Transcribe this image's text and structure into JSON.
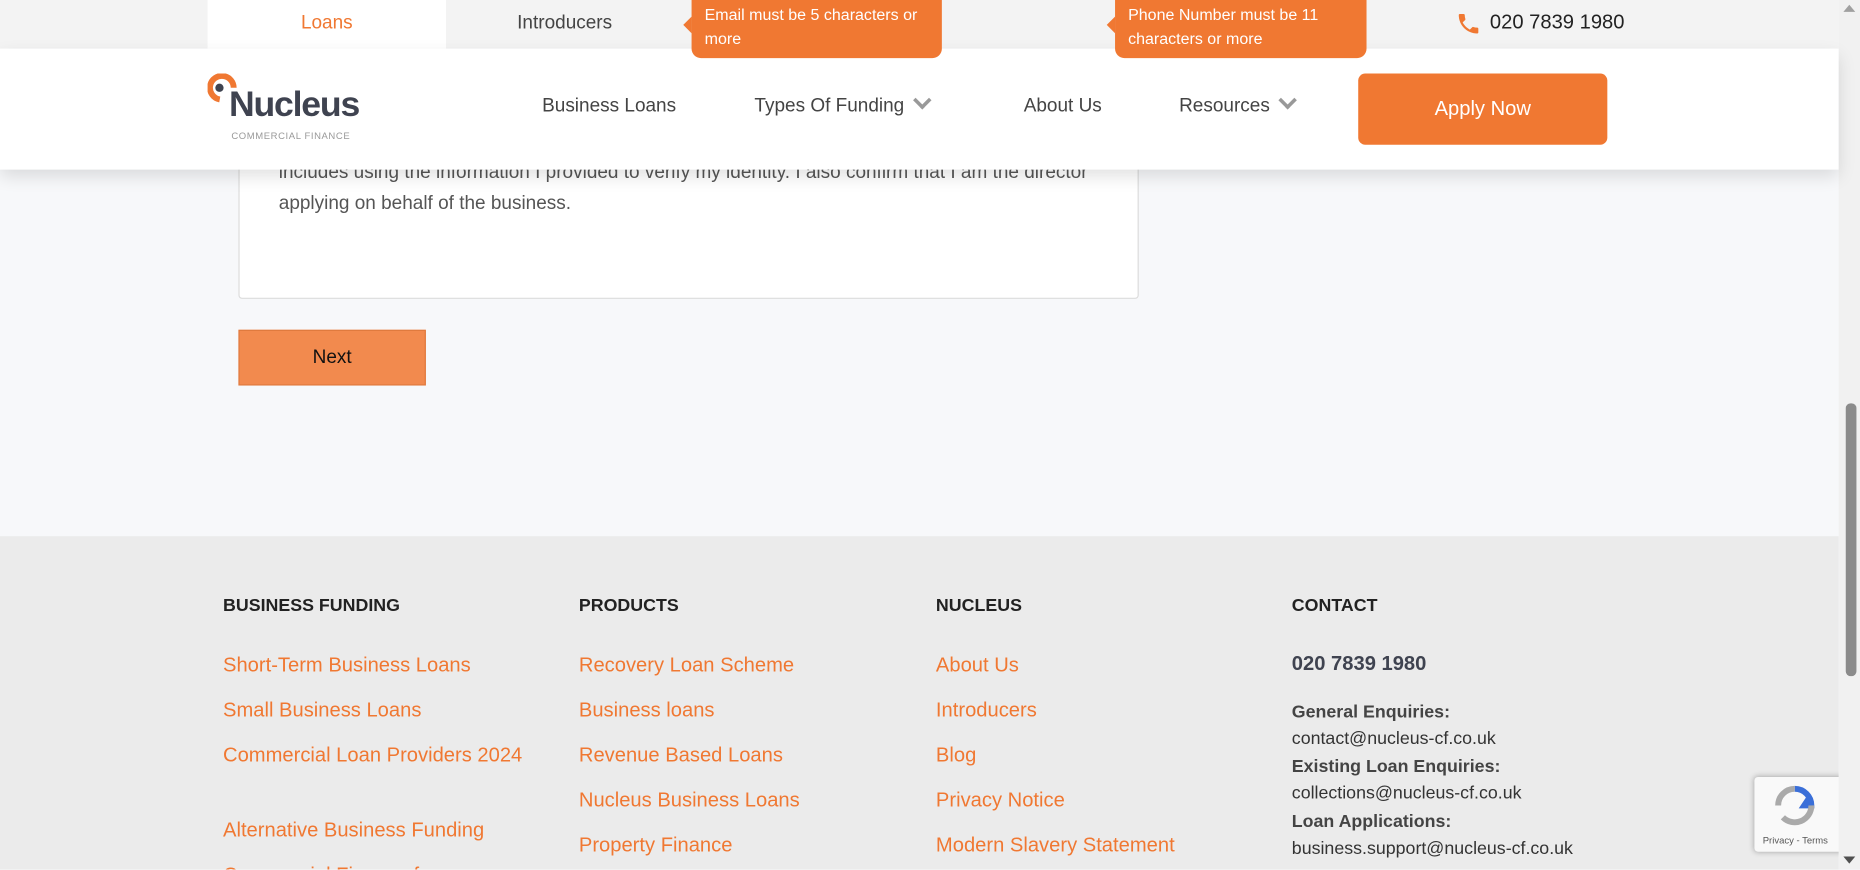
{
  "topbar": {
    "tabs": [
      {
        "label": "Loans",
        "active": true
      },
      {
        "label": "Introducers",
        "active": false
      }
    ],
    "phone": "020 7839 1980"
  },
  "tooltips": {
    "email": "Email must be 5 characters or more",
    "phone": "Phone Number must be 11 characters or more"
  },
  "header": {
    "logo_text": "Nucleus",
    "logo_sub": "COMMERCIAL FINANCE",
    "nav": [
      "Business Loans",
      "Types Of Funding",
      "About Us",
      "Resources"
    ],
    "apply_label": "Apply Now"
  },
  "form": {
    "consent_text": "includes using the information I provided to verify my identity. I also confirm that I am the director applying on behalf of the business.",
    "next_label": "Next"
  },
  "footer": {
    "columns": [
      {
        "heading": "BUSINESS FUNDING",
        "links": [
          "Short-Term Business Loans",
          "Small Business Loans",
          "Commercial Loan Providers 2024",
          "Alternative Business Funding",
          "Commercial Finance f"
        ]
      },
      {
        "heading": "PRODUCTS",
        "links": [
          "Recovery Loan Scheme",
          "Business loans",
          "Revenue Based Loans",
          "Nucleus Business Loans",
          "Property Finance"
        ]
      },
      {
        "heading": "NUCLEUS",
        "links": [
          "About Us",
          "Introducers",
          "Blog",
          "Privacy Notice",
          "Modern Slavery Statement"
        ]
      }
    ],
    "contact": {
      "heading": "CONTACT",
      "phone": "020 7839 1980",
      "items": [
        {
          "label": "General Enquiries:",
          "email": "contact@nucleus-cf.co.uk"
        },
        {
          "label": "Existing Loan Enquiries:",
          "email": "collections@nucleus-cf.co.uk"
        },
        {
          "label": "Loan Applications:",
          "email": "business.support@nucleus-cf.co.uk"
        }
      ]
    }
  },
  "recaptcha": {
    "text": "Privacy - Terms"
  },
  "colors": {
    "accent": "#f07832"
  }
}
